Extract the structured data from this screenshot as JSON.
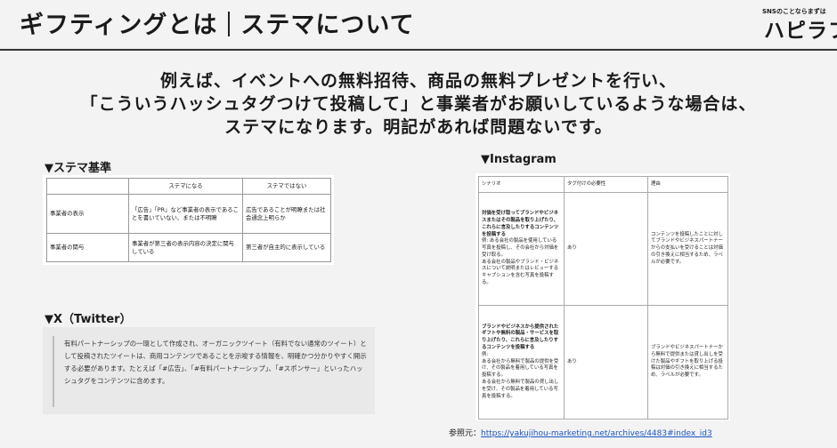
{
  "header": {
    "title_left": "ギフティングとは",
    "title_right": "ステマについて",
    "logo_small": "SNSのことならまずは",
    "logo_main": "ハピラフ"
  },
  "lead": [
    "例えば、イベントへの無料招待、商品の無料プレゼントを行い、",
    "「こういうハッシュタグつけて投稿して」と事業者がお願いしているような場合は、",
    "ステマになります。明記があれば問題ないです。"
  ],
  "stema": {
    "heading": "▼ステマ基準",
    "columns": [
      "",
      "ステマになる",
      "ステマではない"
    ],
    "rows": [
      [
        "事業者の表示",
        "「広告」「PR」など事業者の表示であることを書いていない、または不明瞭",
        "広告であることが明瞭または社会通念上明らか"
      ],
      [
        "事業者の関与",
        "事業者が第三者の表示内容の決定に関与している",
        "第三者が自主的に表示している"
      ]
    ]
  },
  "twitter": {
    "heading": "▼X（Twitter）",
    "body": "有料パートナーシップの一環として作成され、オーガニックツイート（有料でない通常のツイート）として投稿されたツイートは、商用コンテンツであることを示唆する情報を、明確かつ分かりやすく開示する必要があります。たとえば「#広告」、「#有料パートナーシップ」、「#スポンサー」といったハッシュタグをコンテンツに含めます。"
  },
  "instagram": {
    "heading": "▼Instagram",
    "columns": [
      "シナリオ",
      "タグ付けの必要性",
      "理由"
    ],
    "rows": [
      {
        "scenario_bold": "対価を受け取ってブランドやビジネスまたはその製品を取り上げたり、これらに言及したりするコンテンツを投稿する",
        "scenario_detail": "例: ある会社の製品を使用している写真を投稿し、その会社から対価を受け取る。\nある会社の製品やブランド・ビジネスについて説明またはレビューするキャプションを含む写真を投稿する。",
        "need": "あり",
        "reason": "コンテンツを投稿したことに対してブランドやビジネスパートナーからの支払いを受けることは対価の引き換えに相当するため、ラベルが必要です。"
      },
      {
        "scenario_bold": "ブランドやビジネスから提供されたギフトや無料の製品・サービスを取り上げたり、これらに言及したりするコンテンツを投稿する",
        "scenario_detail": "例:\nある会社から無料で製品の提供を受け、その製品を着用している写真を投稿する。\nある会社から無料で製品の貸し出しを受け、その製品を着用している写真を投稿する。",
        "need": "あり",
        "reason": "ブランドやビジネスパートナーから無料で提供または貸し出しを受けた製品やギフトを取り上げる投稿は対価の引き換えに相当するため、ラベルが必要です。"
      }
    ]
  },
  "reference": {
    "label": "参照元：",
    "url": "https://yakujihou-marketing.net/archives/4483#index_id3"
  }
}
